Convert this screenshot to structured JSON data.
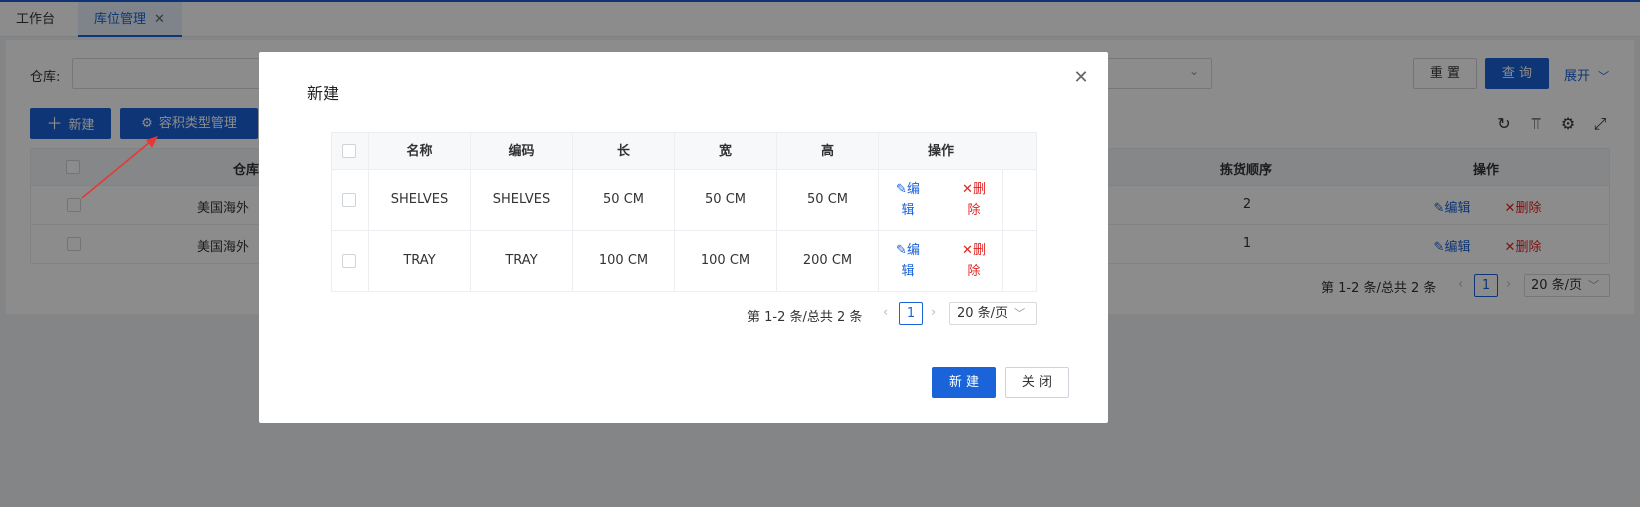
{
  "tabs": [
    {
      "label": "工作台"
    },
    {
      "label": "库位管理",
      "close": "✕"
    }
  ],
  "filter": {
    "warehouse_label": "仓库:",
    "reset_label": "重 置",
    "query_label": "查 询",
    "expand_label": "展开"
  },
  "toolbar": {
    "new_label": "新建",
    "volume_type_label": "容积类型管理"
  },
  "bg_table": {
    "headers": {
      "warehouse": "仓库",
      "pick_order": "拣货顺序",
      "actions": "操作"
    },
    "rows": [
      {
        "warehouse": "美国海外",
        "pick_order": "2",
        "edit": "编辑",
        "delete": "删除"
      },
      {
        "warehouse": "美国海外",
        "pick_order": "1",
        "edit": "编辑",
        "delete": "删除"
      }
    ],
    "pager": {
      "summary": "第 1-2 条/总共 2 条",
      "page": "1",
      "page_size": "20 条/页"
    }
  },
  "modal": {
    "title": "新建",
    "headers": [
      "名称",
      "编码",
      "长",
      "宽",
      "高",
      "操作"
    ],
    "rows": [
      {
        "name": "SHELVES",
        "code": "SHELVES",
        "length": "50 CM",
        "width": "50 CM",
        "height": "50 CM",
        "edit": "编辑",
        "delete": "删除"
      },
      {
        "name": "TRAY",
        "code": "TRAY",
        "length": "100 CM",
        "width": "100 CM",
        "height": "200 CM",
        "edit": "编辑",
        "delete": "删除"
      }
    ],
    "pager": {
      "summary": "第 1-2 条/总共 2 条",
      "page": "1",
      "page_size": "20 条/页"
    },
    "submit_label": "新 建",
    "close_label": "关 闭"
  },
  "colors": {
    "primary": "#1a63d8",
    "danger": "#e02424",
    "annotation_arrow": "#e53935"
  }
}
